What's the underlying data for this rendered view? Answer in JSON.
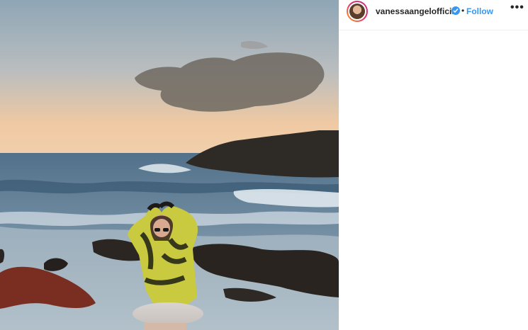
{
  "post": {
    "username": "vanessaangelofficial",
    "separator": "•",
    "follow_label": "Follow",
    "more_icon": "more-options-icon",
    "verified_icon": "verified-badge-icon"
  },
  "colors": {
    "accent": "#3897f0",
    "text": "#262626",
    "border": "#efefef"
  }
}
